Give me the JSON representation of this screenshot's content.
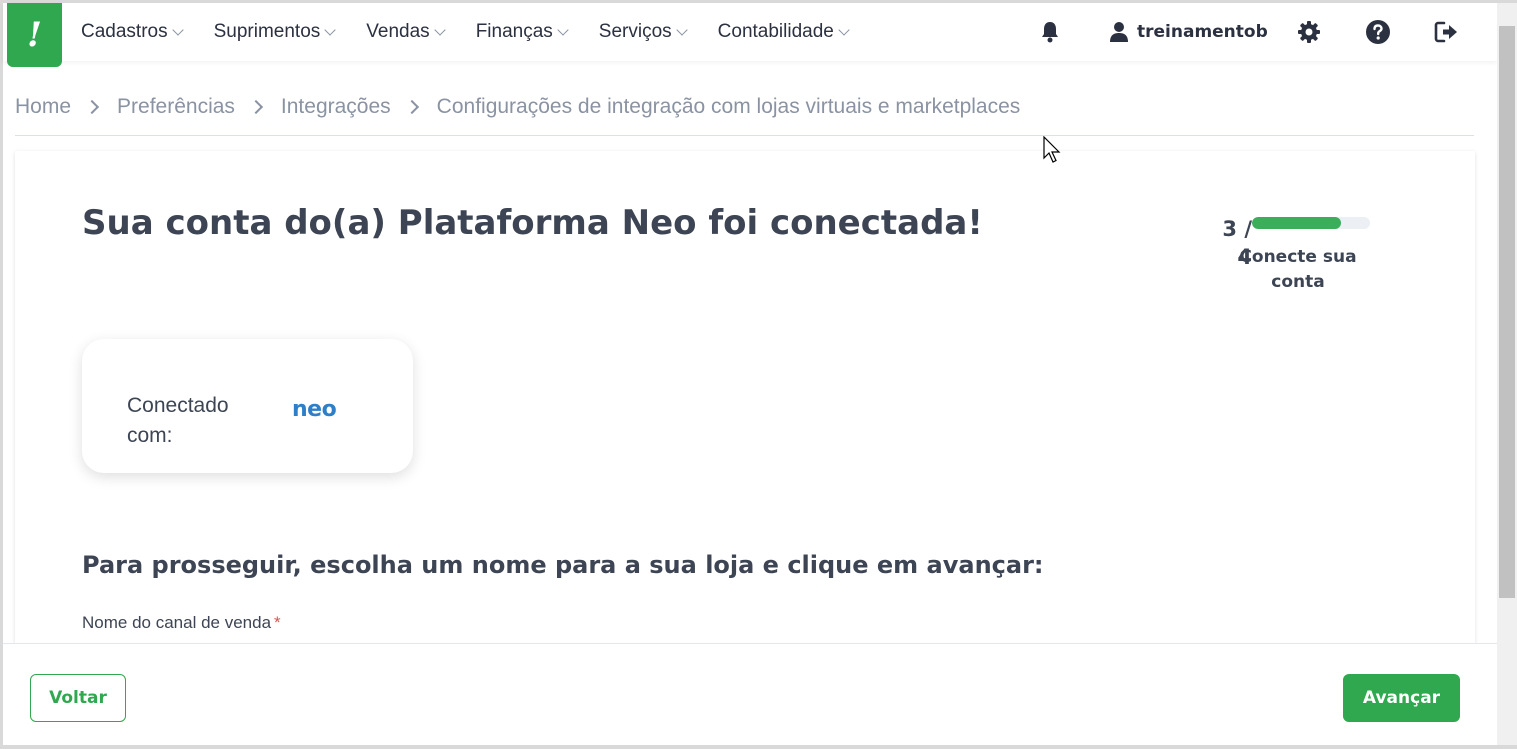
{
  "nav": {
    "logo_glyph": "!",
    "menu": [
      {
        "label": "Cadastros"
      },
      {
        "label": "Suprimentos"
      },
      {
        "label": "Vendas"
      },
      {
        "label": "Finanças"
      },
      {
        "label": "Serviços"
      },
      {
        "label": "Contabilidade"
      }
    ],
    "user_name": "treinamentob",
    "icons": {
      "notifications": "bell-icon",
      "user": "user-icon",
      "settings": "gear-icon",
      "help": "help-icon",
      "logout": "logout-icon"
    }
  },
  "breadcrumb": {
    "items": [
      "Home",
      "Preferências",
      "Integrações"
    ],
    "current": "Configurações de integração com lojas virtuais e marketplaces"
  },
  "main": {
    "headline": "Sua conta do(a) Plataforma Neo foi conectada!",
    "progress": {
      "step_count": "3 / 4",
      "fraction": 0.75,
      "label": "Conecte sua conta"
    },
    "connected": {
      "label": "Conectado com:",
      "logo_text": "neo"
    },
    "subheading": "Para prosseguir, escolha um nome para a sua loja e clique em avançar:",
    "field": {
      "label": "Nome do canal de venda",
      "required_mark": "*"
    }
  },
  "footer": {
    "back_label": "Voltar",
    "next_label": "Avançar"
  },
  "colors": {
    "brand_green": "#2fa84f",
    "text_dark": "#3d4554",
    "muted": "#8a93a3",
    "neo_blue": "#2f7fc8"
  }
}
